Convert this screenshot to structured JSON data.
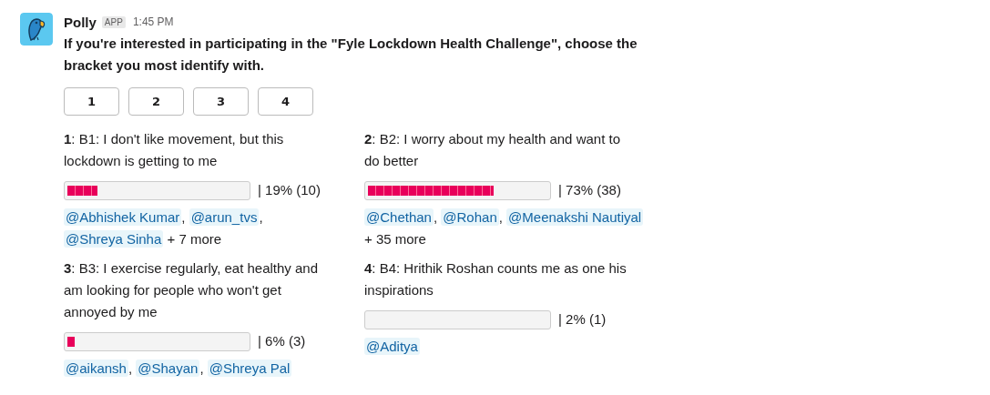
{
  "message": {
    "sender": "Polly",
    "badge": "APP",
    "time": "1:45 PM",
    "text": "If you're interested in participating in the \"Fyle Lockdown Health Challenge\", choose the bracket you most identify with.",
    "buttons": [
      "1",
      "2",
      "3",
      "4"
    ],
    "options": [
      {
        "title": "**1**: B1: I don't like movement, but this lockdown is getting to me",
        "level": 0.17,
        "result": "| 19% (10)",
        "voters": [
          {
            "name": "@Abhishek Kumar",
            "sep": ","
          },
          {
            "name": "@arun_tvs",
            "sep": ","
          },
          {
            "name": "@Shreya Sinha"
          }
        ],
        "more": "+ 7 more"
      },
      {
        "title": "**2**: B2: I worry about my health and want to do better",
        "level": 0.7,
        "result": "| 73% (38)",
        "voters": [
          {
            "name": "@Chethan",
            "sep": ","
          },
          {
            "name": "@Rohan",
            "sep": ","
          },
          {
            "name": "@Meenakshi Nautiyal"
          }
        ],
        "more": "+ 35 more"
      },
      {
        "title": "**3**: B3: I exercise regularly, eat healthy and am looking for people who won't get annoyed by me",
        "level": 0.04,
        "result": "| 6% (3)",
        "voters": [
          {
            "name": "@aikansh",
            "sep": ","
          },
          {
            "name": "@Shayan",
            "sep": ","
          },
          {
            "name": "@Shreya Pal"
          }
        ]
      },
      {
        "title": "**4**: B4: Hrithik Roshan counts me as one his inspirations",
        "result": "| 2% (1)",
        "voters": [
          {
            "name": "@Aditya"
          }
        ]
      }
    ]
  }
}
